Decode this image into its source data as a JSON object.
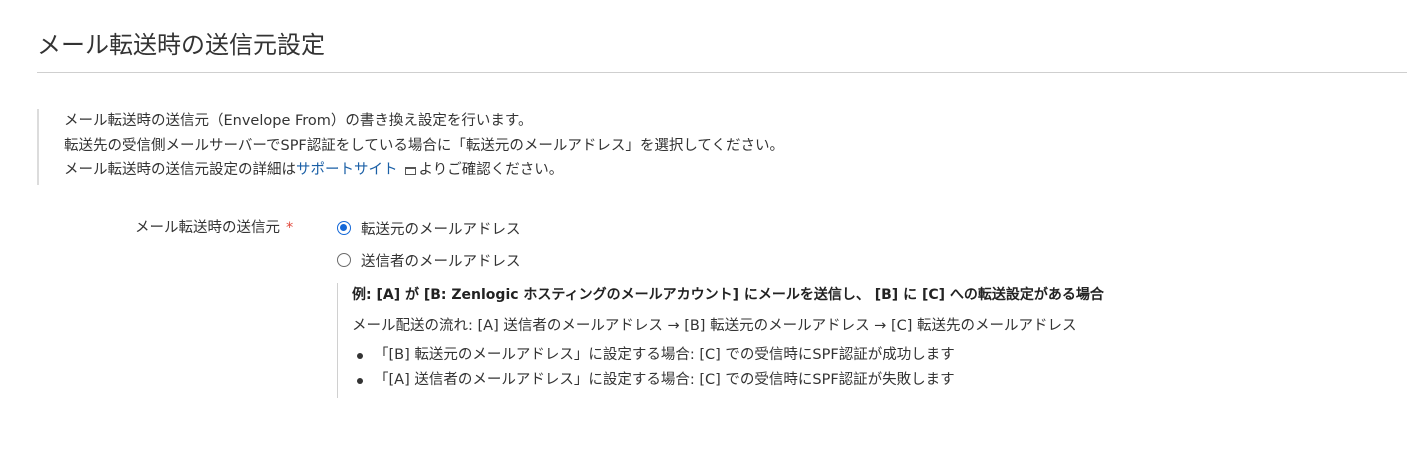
{
  "page": {
    "title": "メール転送時の送信元設定"
  },
  "intro": {
    "line1": "メール転送時の送信元（Envelope From）の書き換え設定を行います。",
    "line2": "転送先の受信側メールサーバーでSPF認証をしている場合に「転送元のメールアドレス」を選択してください。",
    "line3_prefix": "メール転送時の送信元設定の詳細は",
    "line3_link": "サポートサイト",
    "line3_suffix": "よりご確認ください。",
    "link_icon": "external-window-icon",
    "link_color": "#1a5fa6"
  },
  "form": {
    "field_label": "メール転送時の送信元",
    "required_mark": "*",
    "required_color": "#e0473a",
    "options": [
      {
        "label": "転送元のメールアドレス",
        "checked": true
      },
      {
        "label": "送信者のメールアドレス",
        "checked": false
      }
    ],
    "radio_color": "#1468d8"
  },
  "example": {
    "title": "例: [A] が [B: Zenlogic ホスティングのメールアカウント] にメールを送信し、 [B] に [C] への転送設定がある場合",
    "flow": "メール配送の流れ: [A] 送信者のメールアドレス → [B] 転送元のメールアドレス → [C] 転送先のメールアドレス",
    "bullets": [
      "「[B] 転送元のメールアドレス」に設定する場合: [C] での受信時にSPF認証が成功します",
      "「[A] 送信者のメールアドレス」に設定する場合: [C] での受信時にSPF認証が失敗します"
    ]
  }
}
